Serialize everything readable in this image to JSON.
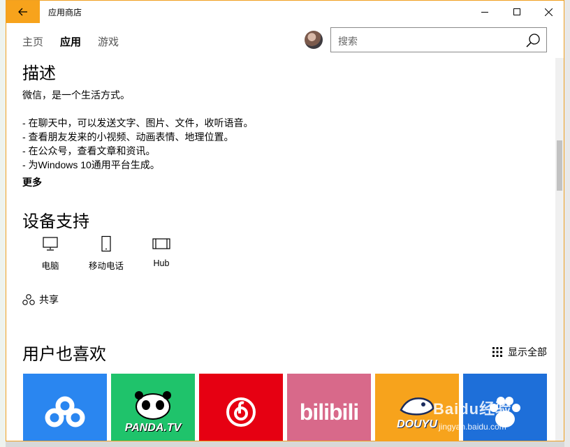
{
  "window": {
    "title": "应用商店"
  },
  "nav": {
    "tabs": [
      "主页",
      "应用",
      "游戏"
    ],
    "active": "应用"
  },
  "search": {
    "placeholder": "搜索"
  },
  "description": {
    "heading": "描述",
    "intro": "微信，是一个生活方式。",
    "bullets": [
      "- 在聊天中，可以发送文字、图片、文件，收听语音。",
      "- 查看朋友发来的小视频、动画表情、地理位置。",
      "- 在公众号，查看文章和资讯。",
      "- 为Windows 10通用平台生成。"
    ],
    "more": "更多"
  },
  "devices": {
    "heading": "设备支持",
    "items": [
      {
        "label": "电脑",
        "icon": "pc-icon"
      },
      {
        "label": "移动电话",
        "icon": "phone-icon"
      },
      {
        "label": "Hub",
        "icon": "hub-icon"
      }
    ]
  },
  "share": {
    "label": "共享"
  },
  "also_like": {
    "heading": "用户也喜欢",
    "show_all": "显示全部",
    "tiles": [
      {
        "name": "baidu-cloud",
        "color": "#2a86f0"
      },
      {
        "name": "panda-tv",
        "color": "#1fc36b",
        "text": "PANDA.TV"
      },
      {
        "name": "netease-music",
        "color": "#e60012"
      },
      {
        "name": "bilibili",
        "color": "#d8698a",
        "text": "bilibili"
      },
      {
        "name": "douyu",
        "color": "#f7a31c",
        "text": "DOUYU"
      },
      {
        "name": "baidu",
        "color": "#1e6fd9"
      }
    ]
  },
  "watermark": {
    "line1": "Baidu经验",
    "line2": "jingyan.baidu.com"
  }
}
